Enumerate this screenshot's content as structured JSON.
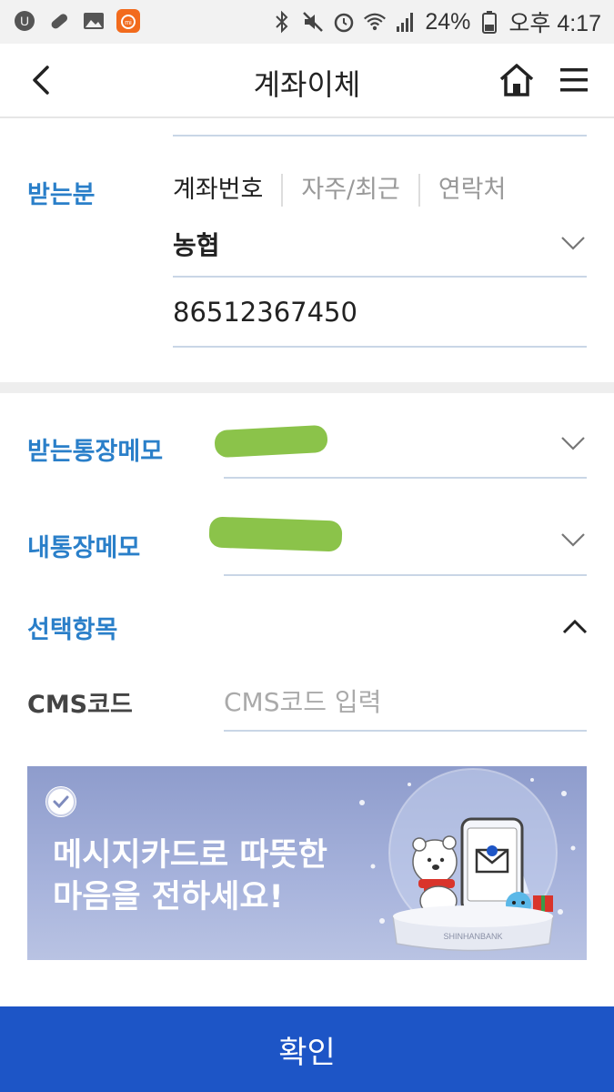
{
  "status_bar": {
    "battery": "24%",
    "time": "오후 4:17",
    "left_icons": [
      "u-plus-icon",
      "pill-icon",
      "gallery-icon",
      "mi-app-icon"
    ],
    "right_icons": [
      "bluetooth-icon",
      "mute-icon",
      "alarm-icon",
      "wifi-icon",
      "signal-icon",
      "battery-icon"
    ]
  },
  "header": {
    "title": "계좌이체",
    "back_icon": "back-chevron-icon",
    "home_icon": "home-icon",
    "menu_icon": "hamburger-menu-icon"
  },
  "recipient": {
    "label": "받는분",
    "tabs": [
      "계좌번호",
      "자주/최근",
      "연락처"
    ],
    "active_tab": "계좌번호",
    "bank": "농협",
    "account_number": "86512367450"
  },
  "memos": {
    "receiver_memo_label": "받는통장메모",
    "my_memo_label": "내통장메모"
  },
  "options": {
    "section_label": "선택항목",
    "cms_label": "CMS코드",
    "cms_placeholder": "CMS코드 입력"
  },
  "banner": {
    "line1": "메시지카드로 따뜻한",
    "line2": "마음을 전하세요!",
    "brand": "SHINHANBANK"
  },
  "confirm_label": "확인",
  "colors": {
    "accent_blue": "#2a7fc9",
    "button_blue": "#1d55c6",
    "redaction_green": "#8bc34a",
    "banner_bg": "#9aa7d5"
  }
}
